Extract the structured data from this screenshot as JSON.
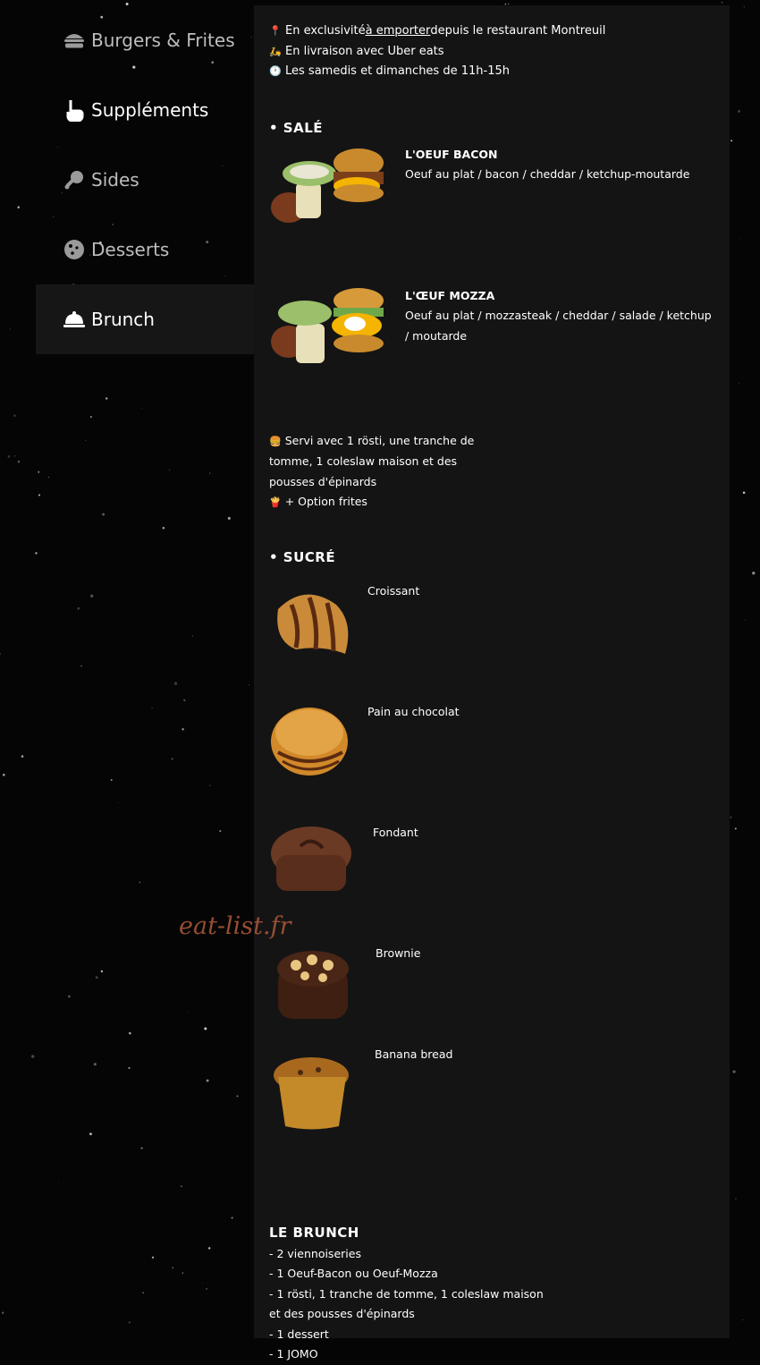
{
  "sidebar": {
    "items": [
      {
        "label": "Burgers & Frites",
        "icon": "burger-icon",
        "active": false
      },
      {
        "label": "Suppléments",
        "icon": "pointing-hand-icon",
        "active": false
      },
      {
        "label": "Sides",
        "icon": "drumstick-icon",
        "active": false
      },
      {
        "label": "Desserts",
        "icon": "cookie-icon",
        "active": false
      },
      {
        "label": "Brunch",
        "icon": "cloche-icon",
        "active": true
      }
    ]
  },
  "info": {
    "line1_pre": "En exclusivité ",
    "line1_link": "à emporter",
    "line1_post": " depuis le restaurant Montreuil",
    "line2": "En livraison avec Uber eats",
    "line3": "Les samedis et dimanches de 11h-15h",
    "icon1": "pin-icon",
    "icon2": "scooter-icon",
    "icon3": "clock-icon"
  },
  "sale": {
    "title": "• SALÉ",
    "items": [
      {
        "name": "L'OEUF BACON",
        "desc": "Oeuf au plat / bacon / cheddar / ketchup-moutarde"
      },
      {
        "name": "L'ŒUF MOZZA",
        "desc": "Oeuf au plat / mozzasteak / cheddar / salade / ketchup / moutarde"
      }
    ],
    "note": "Servi avec 1 rösti, une tranche de tomme, 1 coleslaw maison et des pousses d'épinards",
    "option": "+ Option frites"
  },
  "sucre": {
    "title": "• SUCRÉ",
    "items": [
      {
        "name": "Croissant"
      },
      {
        "name": "Pain au chocolat"
      },
      {
        "name": "Fondant"
      },
      {
        "name": "Brownie"
      },
      {
        "name": "Banana bread"
      }
    ]
  },
  "brunch": {
    "title": "LE BRUNCH",
    "lines": [
      "- 2 viennoiseries",
      "- 1 Oeuf-Bacon ou Oeuf-Mozza",
      "- 1 rösti, 1 tranche de tomme, 1 coleslaw maison",
      "et des pousses d'épinards",
      "- 1 dessert",
      "- 1 JOMO"
    ]
  },
  "watermark": "eat-list.fr"
}
